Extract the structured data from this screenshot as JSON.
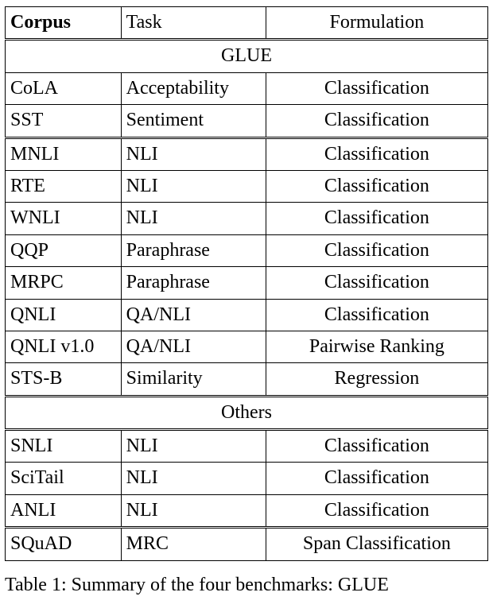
{
  "headers": {
    "corpus": "Corpus",
    "task": "Task",
    "formulation": "Formulation"
  },
  "sections": {
    "glue": "GLUE",
    "others": "Others"
  },
  "glue_top": [
    {
      "corpus": "CoLA",
      "task": "Acceptability",
      "formulation": "Classification"
    },
    {
      "corpus": "SST",
      "task": "Sentiment",
      "formulation": "Classification"
    }
  ],
  "glue_rest": [
    {
      "corpus": "MNLI",
      "task": "NLI",
      "formulation": "Classification"
    },
    {
      "corpus": "RTE",
      "task": "NLI",
      "formulation": "Classification"
    },
    {
      "corpus": "WNLI",
      "task": "NLI",
      "formulation": "Classification"
    },
    {
      "corpus": "QQP",
      "task": "Paraphrase",
      "formulation": "Classification"
    },
    {
      "corpus": "MRPC",
      "task": "Paraphrase",
      "formulation": "Classification"
    },
    {
      "corpus": "QNLI",
      "task": "QA/NLI",
      "formulation": "Classification"
    },
    {
      "corpus": "QNLI v1.0",
      "task": "QA/NLI",
      "formulation": "Pairwise Ranking"
    },
    {
      "corpus": "STS-B",
      "task": "Similarity",
      "formulation": "Regression"
    }
  ],
  "others_top": [
    {
      "corpus": "SNLI",
      "task": "NLI",
      "formulation": "Classification"
    },
    {
      "corpus": "SciTail",
      "task": "NLI",
      "formulation": "Classification"
    },
    {
      "corpus": "ANLI",
      "task": "NLI",
      "formulation": "Classification"
    }
  ],
  "others_rest": [
    {
      "corpus": "SQuAD",
      "task": "MRC",
      "formulation": "Span Classification"
    }
  ],
  "caption": "Table 1:  Summary of the four benchmarks:  GLUE"
}
